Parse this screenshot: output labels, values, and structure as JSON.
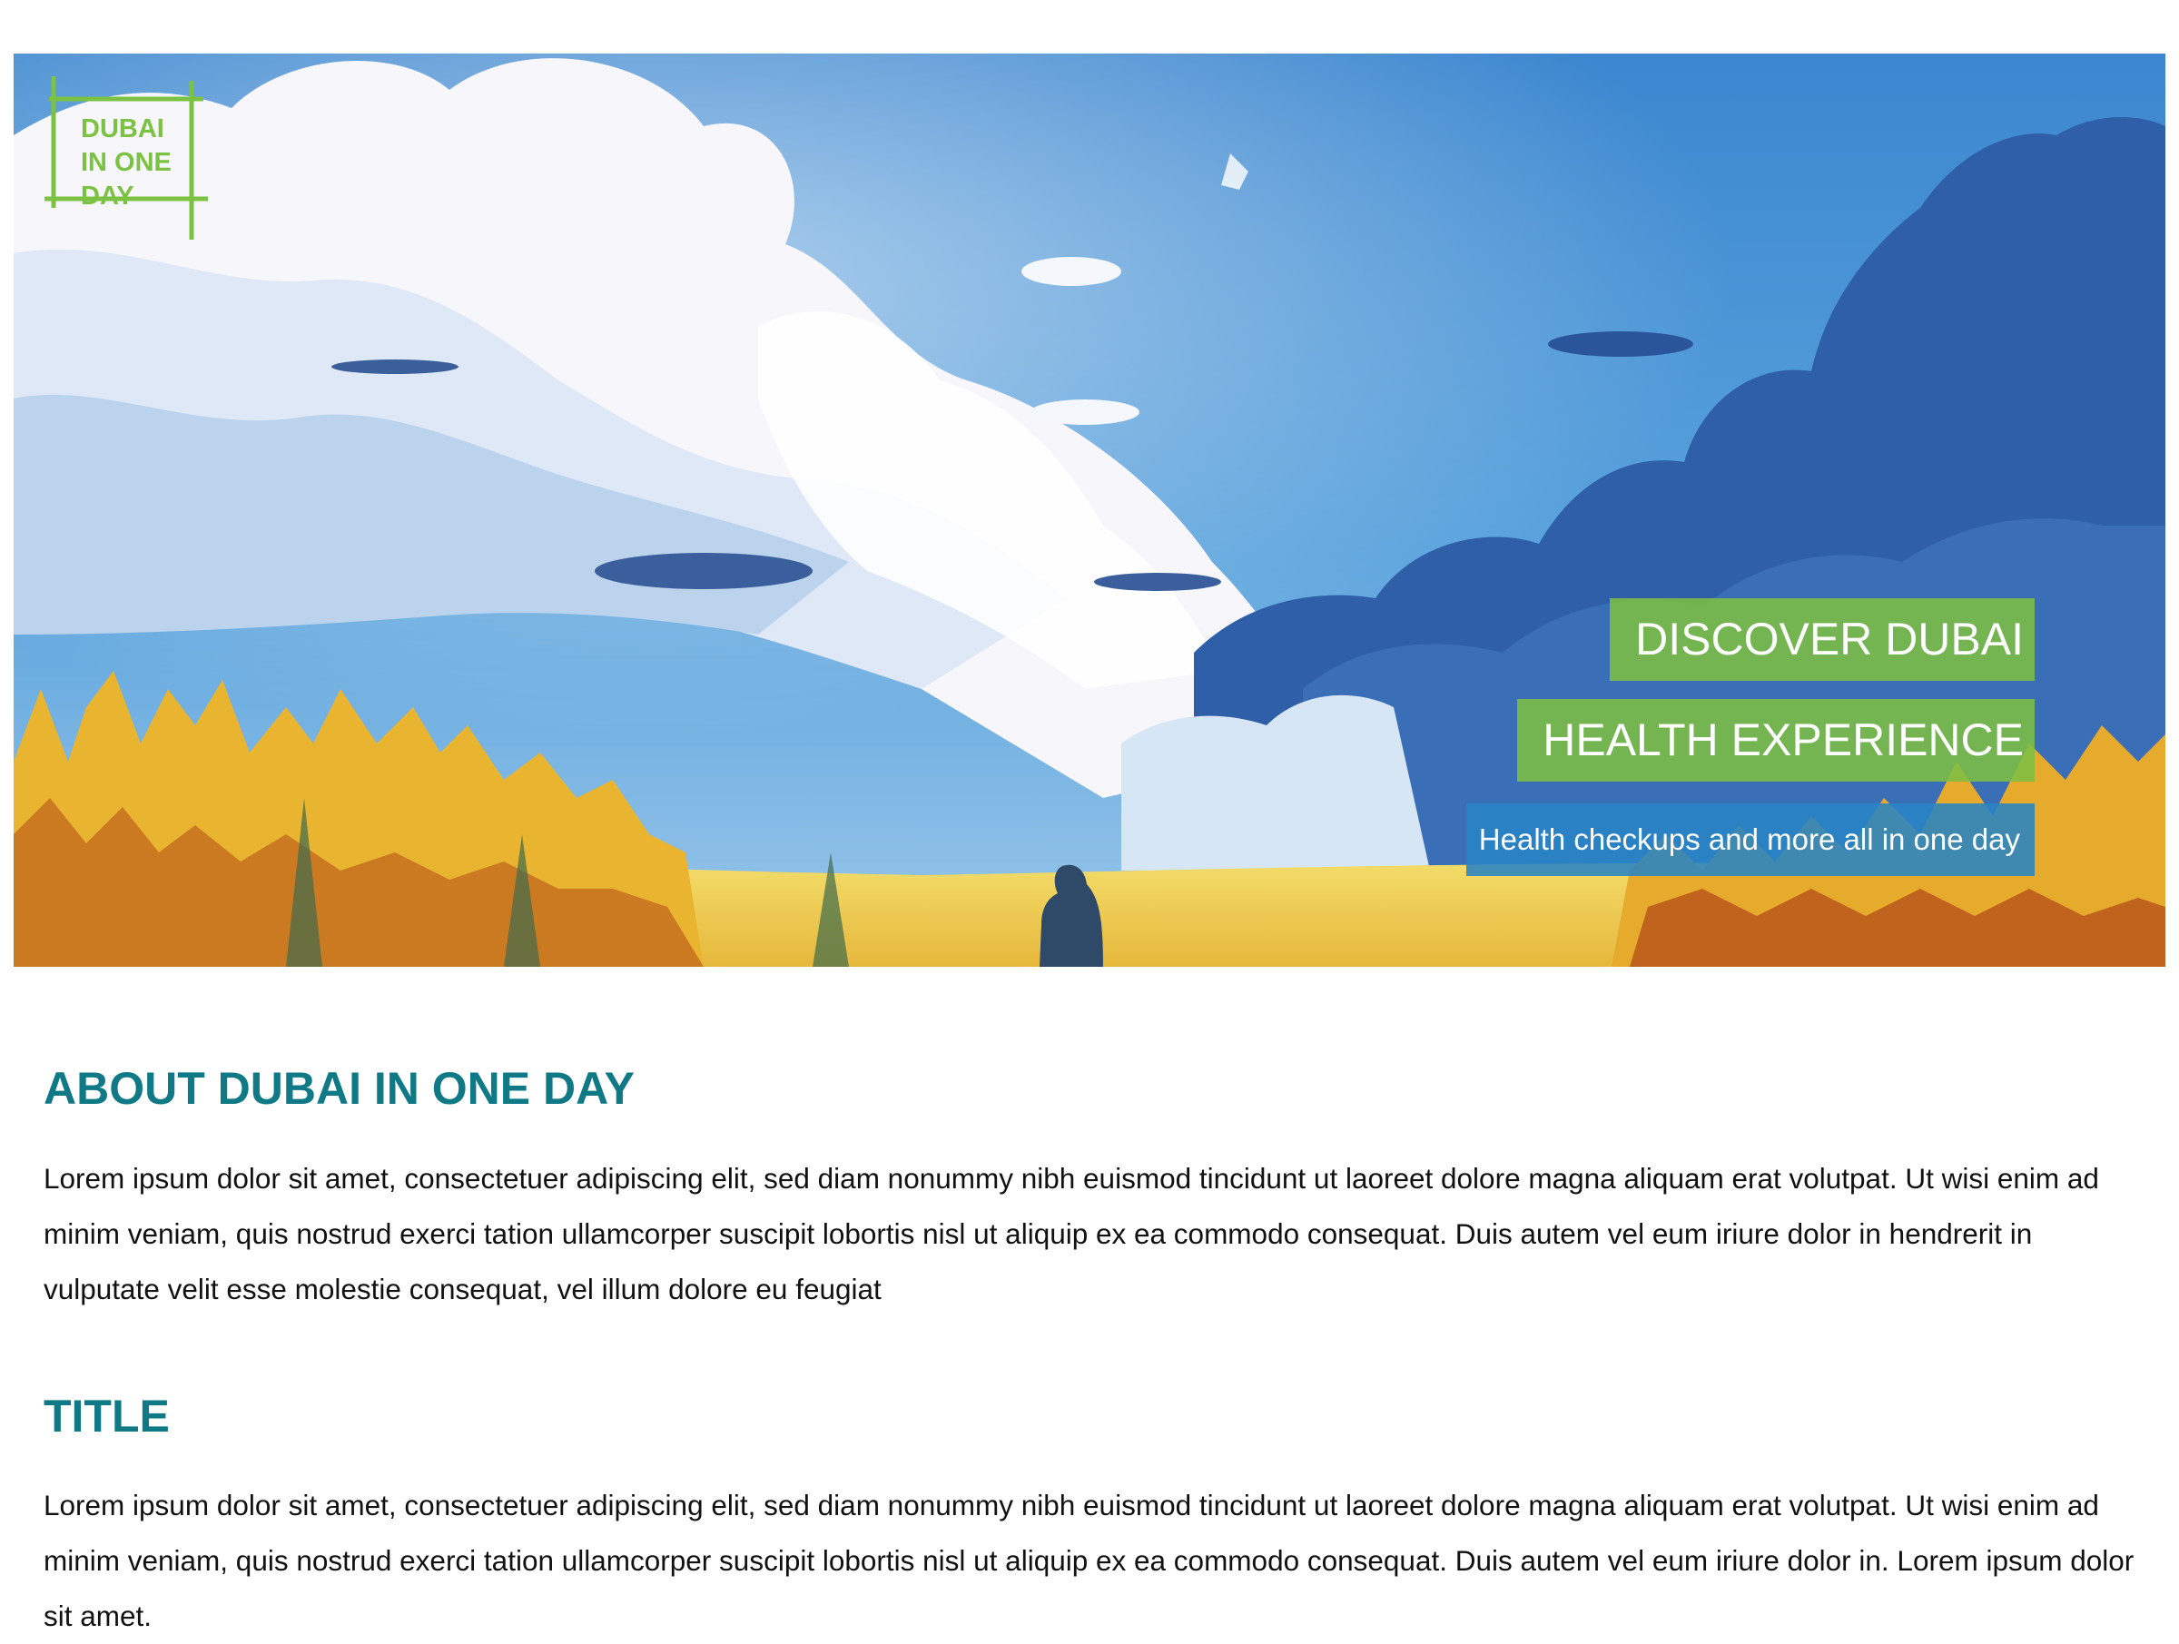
{
  "hero": {
    "logo_text": "DUBAI\nIN ONE\nDAY",
    "banner_line1": "DISCOVER DUBAI",
    "banner_line2": "HEALTH EXPERIENCE",
    "banner_subtitle": "Health checkups and more all in one day",
    "colors": {
      "green": "#7cbe42",
      "blue": "#2884c4"
    }
  },
  "sections": [
    {
      "title": "ABOUT DUBAI IN ONE DAY",
      "text": "Lorem ipsum dolor sit amet, consectetuer adipiscing elit, sed diam nonummy nibh euismod tincidunt ut laoreet dolore magna aliquam erat volutpat. Ut wisi enim ad minim veniam, quis nostrud exerci tation ullamcorper suscipit lobortis nisl ut aliquip ex ea commodo consequat. Duis autem vel eum iriure dolor in hendrerit in vulputate velit esse molestie consequat, vel illum dolore eu feugiat"
    },
    {
      "title": "TITLE",
      "text": "Lorem ipsum dolor sit amet, consectetuer adipiscing elit, sed diam nonummy nibh euismod tincidunt ut laoreet dolore magna aliquam erat volutpat. Ut wisi enim ad minim veniam, quis nostrud exerci tation ullamcorper suscipit lobortis nisl ut aliquip ex ea commodo consequat. Duis autem vel eum iriure dolor in. Lorem ipsum dolor sit amet."
    }
  ],
  "theme": {
    "heading_color": "#0f7a85"
  }
}
